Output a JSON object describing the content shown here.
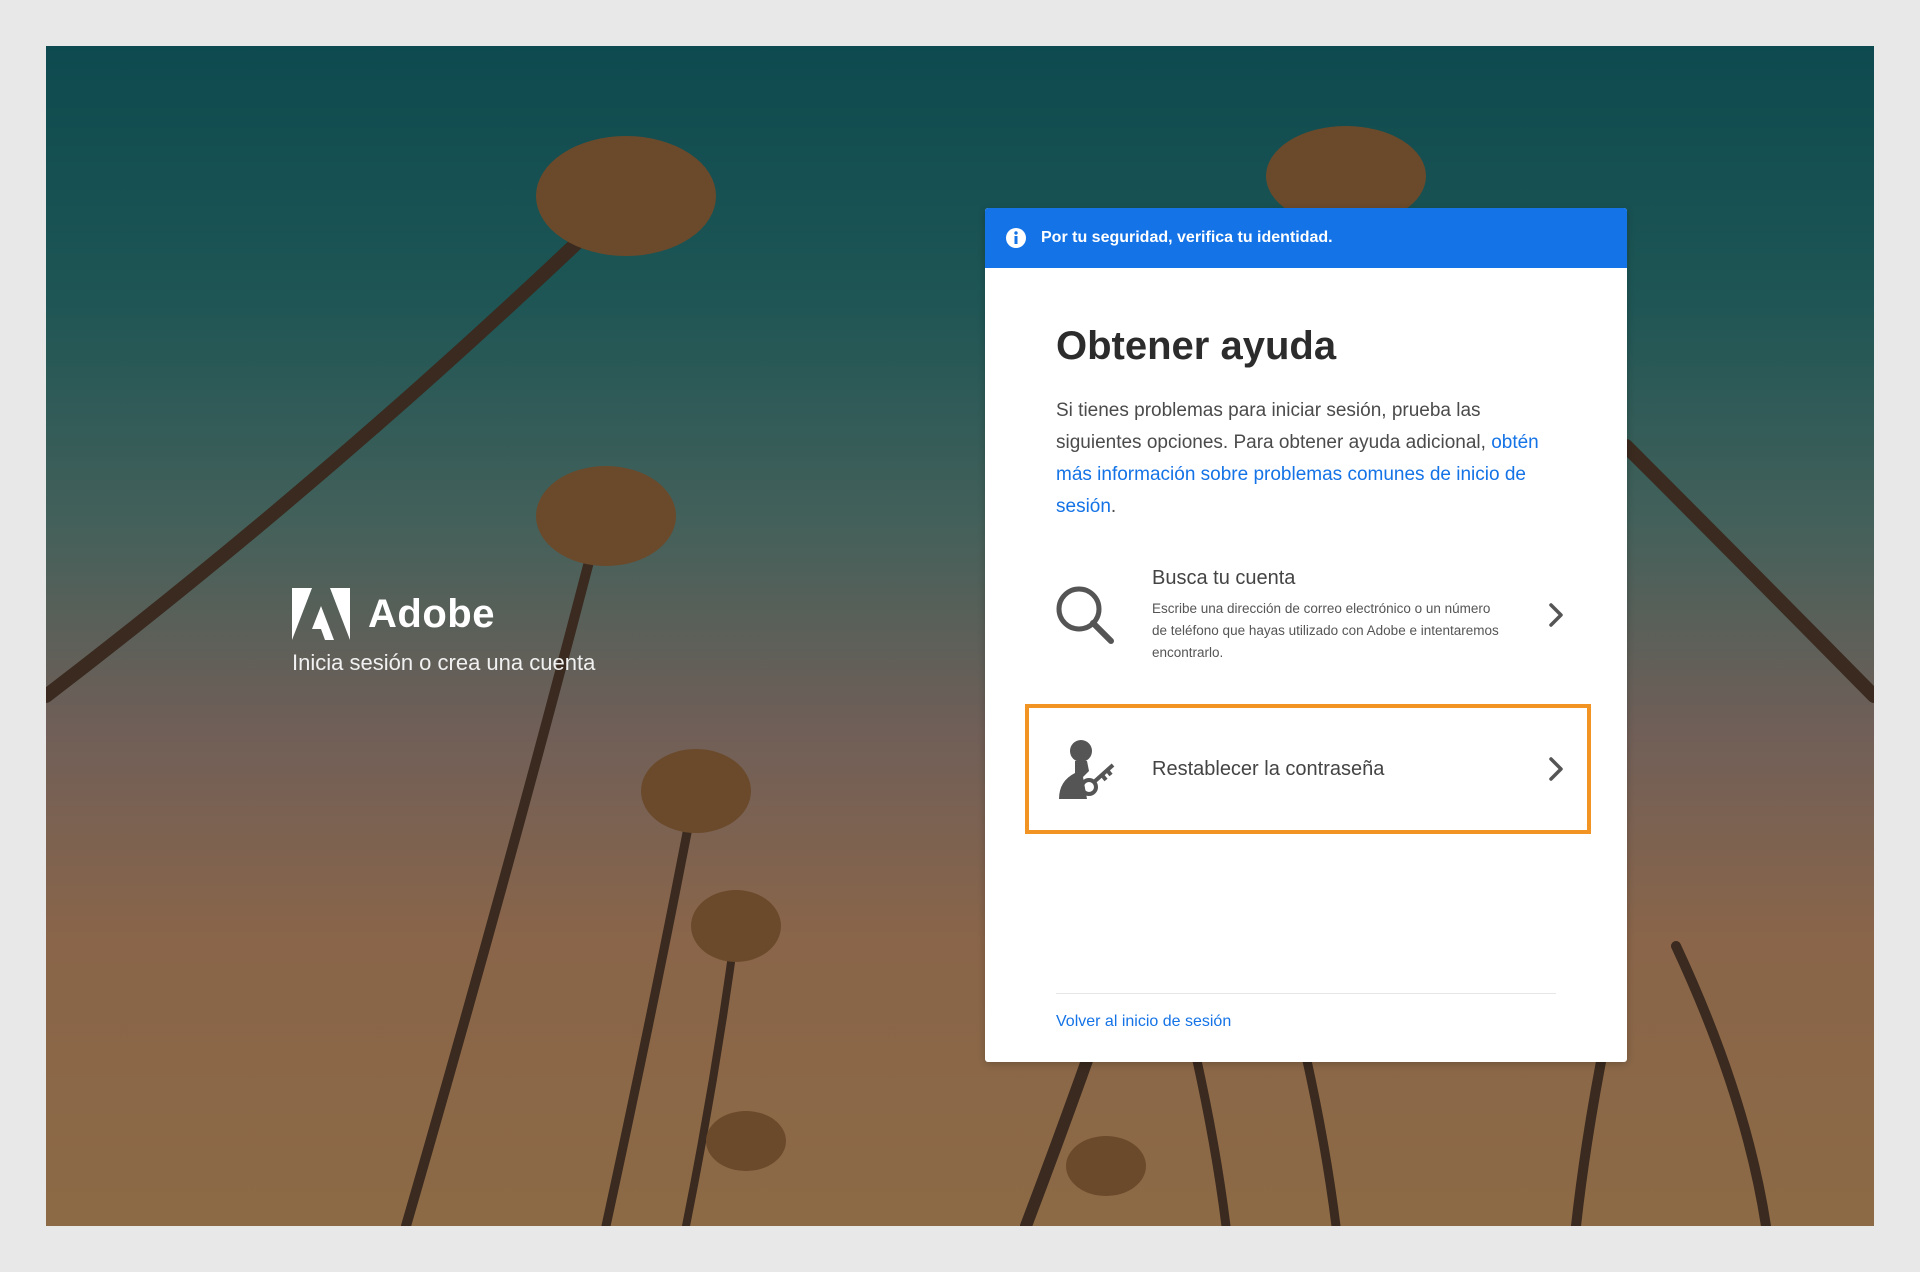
{
  "brand": {
    "name": "Adobe",
    "tagline": "Inicia sesión o crea una cuenta"
  },
  "banner": {
    "icon": "info-icon",
    "text": "Por tu seguridad, verifica tu identidad."
  },
  "help": {
    "title": "Obtener ayuda",
    "description": "Si tienes problemas para iniciar sesión, prueba las siguientes opciones. Para obtener ayuda adicional, ",
    "link_text": "obtén más información sobre problemas comunes de inicio de sesión",
    "description_end": "."
  },
  "options": [
    {
      "icon": "search-icon",
      "title": "Busca tu cuenta",
      "description": "Escribe una dirección de correo electrónico o un número de teléfono que hayas utilizado con Adobe e intentaremos encontrarlo."
    },
    {
      "icon": "user-key-icon",
      "title": "Restablecer la contraseña",
      "description": ""
    }
  ],
  "footer": {
    "back_link": "Volver al inicio de sesión"
  },
  "colors": {
    "accent": "#1473e6",
    "highlight": "#f29423"
  }
}
